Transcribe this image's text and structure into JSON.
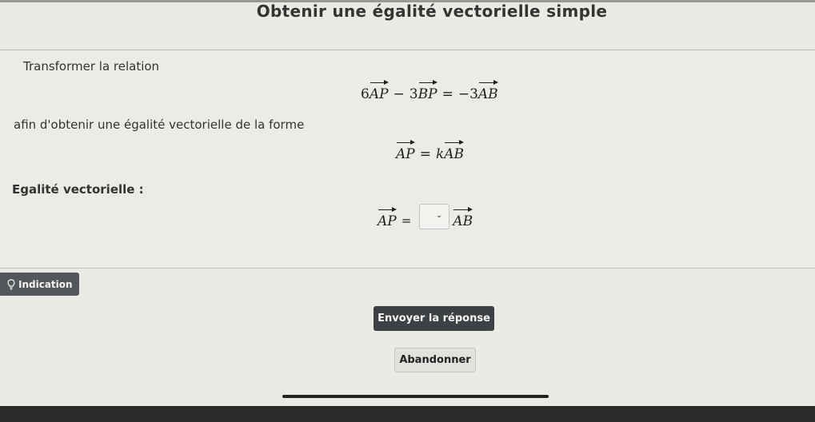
{
  "header": {
    "title": "Obtenir une égalité vectorielle simple"
  },
  "exercise": {
    "instruction": "Transformer la relation",
    "relation": {
      "term1_coef": "6",
      "term1_vec": "AP",
      "minus": "−",
      "term2_coef": "3",
      "term2_vec": "BP",
      "equals": "=",
      "rhs_sign": "−",
      "rhs_coef": "3",
      "rhs_vec": "AB"
    },
    "target_text": "afin d'obtenir une égalité vectorielle de la forme",
    "target_form": {
      "lhs_vec": "AP",
      "equals": "=",
      "k": "k",
      "rhs_vec": "AB"
    },
    "answer_label": "Egalité vectorielle :",
    "answer": {
      "lhs_vec": "AP",
      "equals": "=",
      "selected_value": "",
      "rhs_vec": "AB"
    }
  },
  "actions": {
    "hint_label": "Indication",
    "submit_label": "Envoyer la réponse",
    "abandon_label": "Abandonner"
  }
}
